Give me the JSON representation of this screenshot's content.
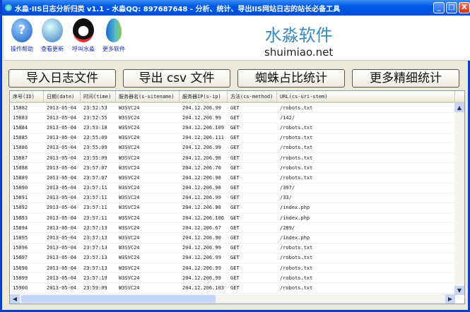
{
  "window": {
    "title": "水淼·IIS日志分析归类 v1.1 - 水淼QQ: 897687648 - 分析、统计、导出IIS网站日志的站长必备工具",
    "min": "_",
    "max": "□",
    "close": "X"
  },
  "toolbar": {
    "items": [
      {
        "label": "操作帮助",
        "icon": "help-icon"
      },
      {
        "label": "查看更新",
        "icon": "globe-icon"
      },
      {
        "label": "呼叫水淼",
        "icon": "qq-penguin-icon"
      },
      {
        "label": "更多软件",
        "icon": "water-drop-icon"
      }
    ]
  },
  "brand": {
    "cn": "水淼软件",
    "en": "shuimiao.net"
  },
  "buttons": [
    "导入日志文件",
    "导出 csv 文件",
    "蜘蛛占比统计",
    "更多精细统计"
  ],
  "table": {
    "columns": [
      "序号(ID)",
      "日期(date)",
      "时间(time)",
      "服务器名(s-sitename)",
      "服务器IP(s-ip)",
      "方法(cs-method)",
      "URL(cs-uri-stem)"
    ],
    "rows": [
      [
        "15882",
        "2013-05-04",
        "23:52:53",
        "W3SVC24",
        "204.12.206.99",
        "GET",
        "/robots.txt"
      ],
      [
        "15883",
        "2013-05-04",
        "23:52:55",
        "W3SVC24",
        "204.12.206.99",
        "GET",
        "/142/"
      ],
      [
        "15884",
        "2013-05-04",
        "23:53:18",
        "W3SVC24",
        "204.12.206.109",
        "GET",
        "/robots.txt"
      ],
      [
        "15885",
        "2013-05-04",
        "23:55:09",
        "W3SVC24",
        "204.12.206.111",
        "GET",
        "/robots.txt"
      ],
      [
        "15886",
        "2013-05-04",
        "23:55:09",
        "W3SVC24",
        "204.12.206.99",
        "GET",
        "/robots.txt"
      ],
      [
        "15887",
        "2013-05-04",
        "23:55:09",
        "W3SVC24",
        "204.12.206.98",
        "GET",
        "/robots.txt"
      ],
      [
        "15888",
        "2013-05-04",
        "23:57:07",
        "W3SVC24",
        "204.12.206.70",
        "GET",
        "/robots.txt"
      ],
      [
        "15889",
        "2013-05-04",
        "23:57:07",
        "W3SVC24",
        "204.12.206.98",
        "GET",
        "/robots.txt"
      ],
      [
        "15890",
        "2013-05-04",
        "23:57:11",
        "W3SVC24",
        "204.12.206.98",
        "GET",
        "/397/"
      ],
      [
        "15891",
        "2013-05-04",
        "23:57:11",
        "W3SVC24",
        "204.12.206.99",
        "GET",
        "/33/"
      ],
      [
        "15892",
        "2013-05-04",
        "23:57:11",
        "W3SVC24",
        "204.12.206.98",
        "GET",
        "/index.php"
      ],
      [
        "15893",
        "2013-05-04",
        "23:57:11",
        "W3SVC24",
        "204.12.206.106",
        "GET",
        "/index.php"
      ],
      [
        "15894",
        "2013-05-04",
        "23:57:13",
        "W3SVC24",
        "204.12.206.67",
        "GET",
        "/209/"
      ],
      [
        "15895",
        "2013-05-04",
        "23:57:13",
        "W3SVC24",
        "204.12.206.90",
        "GET",
        "/index.php"
      ],
      [
        "15896",
        "2013-05-04",
        "23:57:13",
        "W3SVC24",
        "204.12.206.99",
        "GET",
        "/robots.txt"
      ],
      [
        "15897",
        "2013-05-04",
        "23:57:13",
        "W3SVC24",
        "204.12.206.99",
        "GET",
        "/robots.txt"
      ],
      [
        "15898",
        "2013-05-04",
        "23:57:13",
        "W3SVC24",
        "204.12.206.99",
        "GET",
        "/robots.txt"
      ],
      [
        "15899",
        "2013-05-04",
        "23:57:19",
        "W3SVC24",
        "204.12.206.99",
        "GET",
        "/robots.txt"
      ],
      [
        "15900",
        "2013-05-04",
        "23:59:09",
        "W3SVC24",
        "204.12.206.103",
        "GET",
        "/robots.txt"
      ]
    ]
  }
}
